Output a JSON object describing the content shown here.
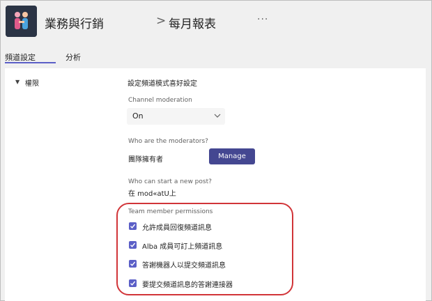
{
  "header": {
    "team_name": "業務與行銷",
    "separator": ">",
    "channel_name": "每月報表",
    "more_label": "···"
  },
  "tabs": [
    {
      "label": "頻道設定",
      "active": true
    },
    {
      "label": "分析",
      "active": false
    }
  ],
  "sidebar": {
    "permissions_label": "權限"
  },
  "settings": {
    "section_title": "設定頻道模式喜好設定",
    "moderation": {
      "label": "Channel moderation",
      "value": "On"
    },
    "moderators": {
      "label": "Who are the moderators?",
      "value": "團隊擁有者",
      "manage_label": "Manage"
    },
    "new_post": {
      "label": "Who can start a new post?",
      "value": "在 mod«atU上"
    },
    "member_permissions": {
      "label": "Team member permissions",
      "options": [
        {
          "label": "允許成員回復頻道訊息",
          "checked": true
        },
        {
          "label": "Alba 成員可訂上頻道訊息",
          "checked": true
        },
        {
          "label": "答謝機器人以提交頻道訊息",
          "checked": true
        },
        {
          "label": "要提交頻道訊息的答謝連接器",
          "checked": true
        }
      ]
    }
  },
  "colors": {
    "accent": "#5b5fc7",
    "button": "#444791",
    "highlight": "#d13438"
  }
}
